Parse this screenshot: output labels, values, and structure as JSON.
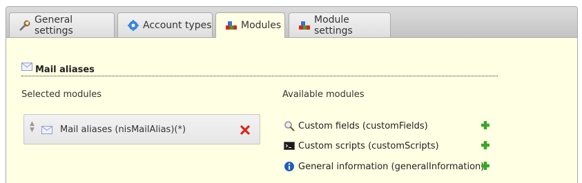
{
  "tabs": [
    {
      "label": "General settings",
      "icon": "wrench-icon"
    },
    {
      "label": "Account types",
      "icon": "gear-icon"
    },
    {
      "label": "Modules",
      "icon": "modules-icon",
      "active": true
    },
    {
      "label": "Module settings",
      "icon": "modules-icon"
    }
  ],
  "section": {
    "title": "Mail aliases",
    "icon": "envelope-icon"
  },
  "selected": {
    "heading": "Selected modules",
    "items": [
      {
        "label": "Mail aliases (nisMailAlias)(*)",
        "icon": "envelope-icon",
        "remove_icon": "red-x-icon"
      }
    ]
  },
  "available": {
    "heading": "Available modules",
    "items": [
      {
        "label": "Custom fields (customFields)",
        "icon": "magnifier-icon",
        "add_icon": "green-plus-icon"
      },
      {
        "label": "Custom scripts (customScripts)",
        "icon": "terminal-icon",
        "add_icon": "green-plus-icon"
      },
      {
        "label": "General information (generalInformation)",
        "icon": "info-icon",
        "add_icon": "green-plus-icon"
      }
    ]
  },
  "colors": {
    "panel_bg": "#ffffe3",
    "tabbar_bg": "#c8c8c8",
    "remove": "#d9261c",
    "add": "#3aa52a",
    "info": "#1f5fbf"
  }
}
